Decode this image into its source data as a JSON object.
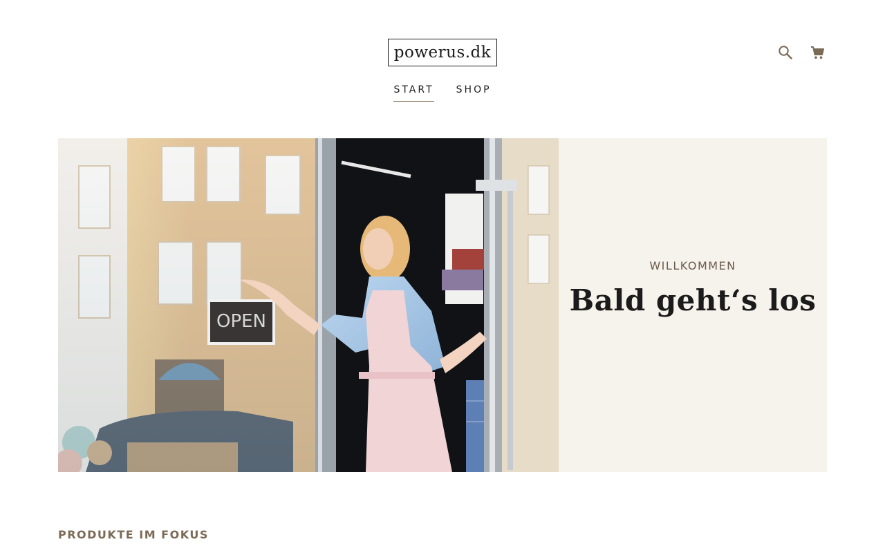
{
  "header": {
    "logo_text": "powerus.dk",
    "icons": {
      "search": "search-icon",
      "cart": "cart-icon"
    },
    "accent_color": "#7b6a55"
  },
  "nav": {
    "items": [
      {
        "label": "START",
        "active": true
      },
      {
        "label": "SHOP",
        "active": false
      }
    ]
  },
  "hero": {
    "image_alt": "Frau öffnet Ladentür mit OPEN-Schild",
    "sign_text": "OPEN",
    "kicker": "WILLKOMMEN",
    "title": "Bald geht‘s los",
    "panel_color": "#f6f2ec"
  },
  "sections": {
    "featured_title": "PRODUKTE IM FOKUS"
  }
}
